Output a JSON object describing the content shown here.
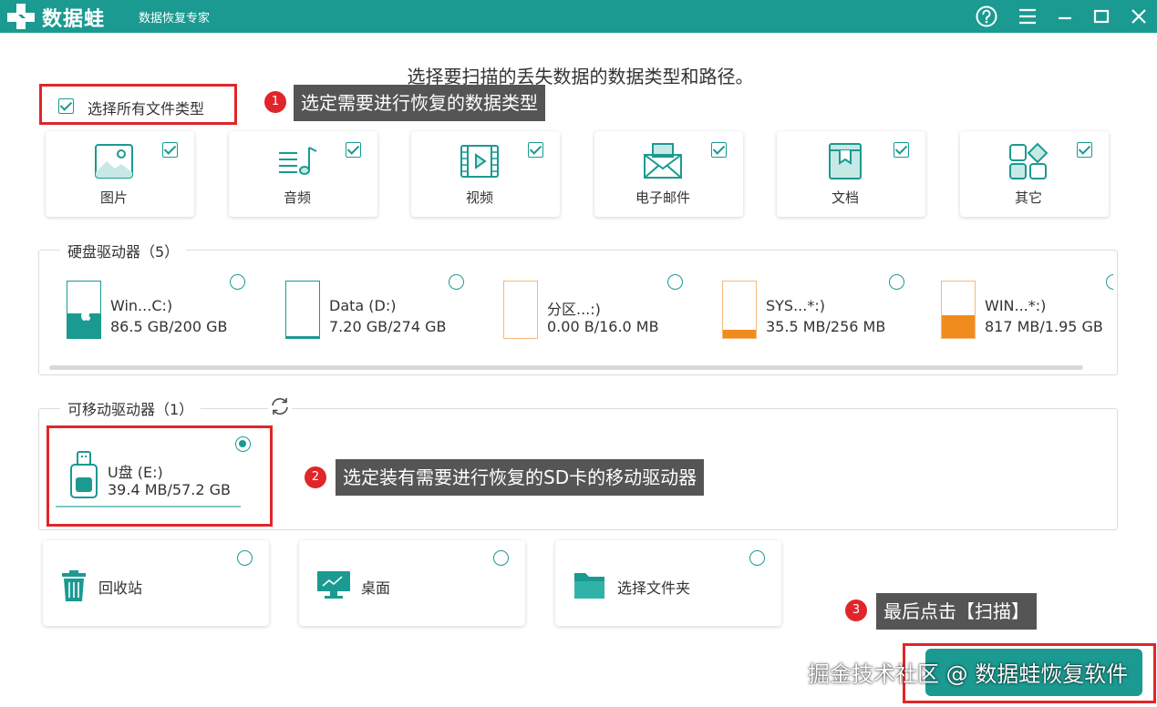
{
  "titlebar": {
    "brand": "数据蛙",
    "subtitle": "数据恢复专家",
    "buttons": [
      "help-icon",
      "menu-icon",
      "minimize-icon",
      "maximize-icon",
      "close-icon"
    ]
  },
  "heading": "选择要扫描的丢失数据的数据类型和路径。",
  "select_all": {
    "label": "选择所有文件类型",
    "checked": true
  },
  "callouts": [
    {
      "num": "1",
      "text": "选定需要进行恢复的数据类型"
    },
    {
      "num": "2",
      "text": "选定装有需要进行恢复的SD卡的移动驱动器"
    },
    {
      "num": "3",
      "text": "最后点击【扫描】"
    }
  ],
  "file_types": [
    {
      "label": "图片",
      "icon": "image-icon",
      "checked": true
    },
    {
      "label": "音频",
      "icon": "audio-icon",
      "checked": true
    },
    {
      "label": "视频",
      "icon": "video-icon",
      "checked": true
    },
    {
      "label": "电子邮件",
      "icon": "email-icon",
      "checked": true
    },
    {
      "label": "文档",
      "icon": "document-icon",
      "checked": true
    },
    {
      "label": "其它",
      "icon": "other-icon",
      "checked": true
    }
  ],
  "hard_drives": {
    "label": "硬盘驱动器（5）",
    "items": [
      {
        "name": "Win...C:)",
        "size": "86.5 GB/200 GB",
        "used_fraction": 0.43,
        "color": "#1a9a91",
        "icon": "windows-logo-icon"
      },
      {
        "name": "Data (D:)",
        "size": "7.20 GB/274 GB",
        "used_fraction": 0.03,
        "color": "#1a9a91"
      },
      {
        "name": "分区...:)",
        "size": "0.00  B/16.0 MB",
        "used_fraction": 0.0,
        "color": "#f0a050"
      },
      {
        "name": "SYS...*:)",
        "size": "35.5 MB/256 MB",
        "used_fraction": 0.14,
        "color": "#f08c1e"
      },
      {
        "name": "WIN...*:)",
        "size": "817 MB/1.95 GB",
        "used_fraction": 0.41,
        "color": "#f08c1e"
      }
    ]
  },
  "removable_drives": {
    "label": "可移动驱动器（1）",
    "refresh_icon": "refresh-icon",
    "items": [
      {
        "name": "U盘 (E:)",
        "size": "39.4 MB/57.2 GB",
        "selected": true,
        "icon": "usb-drive-icon"
      }
    ]
  },
  "locations": [
    {
      "label": "回收站",
      "icon": "recycle-bin-icon"
    },
    {
      "label": "桌面",
      "icon": "desktop-icon"
    },
    {
      "label": "选择文件夹",
      "icon": "folder-icon"
    }
  ],
  "watermark": "掘金技术社区 @ 数据蛙恢复软件"
}
